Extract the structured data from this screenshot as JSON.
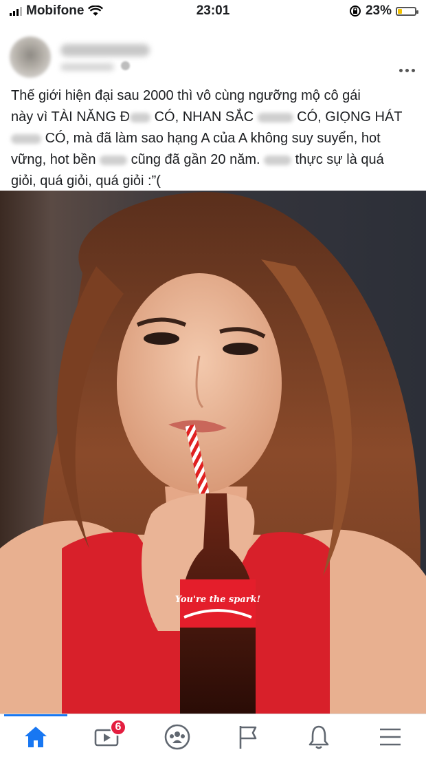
{
  "status_bar": {
    "carrier": "Mobifone",
    "time": "23:01",
    "battery": "23%",
    "battery_level": 0.23,
    "icons": [
      "signal-icon",
      "wifi-icon",
      "orientation-lock-icon",
      "battery-icon"
    ]
  },
  "post": {
    "more_label": "•••",
    "caption": {
      "line1": "Thế giới hiện đại sau 2000 thì vô cùng ngưỡng mộ cô gái",
      "line2_a": "này vì TÀI NĂNG Đ",
      "line2_b": "CÓ, NHAN SẮC",
      "line2_c": "CÓ, GIỌNG HÁT",
      "line3_a": "CÓ, mà đã làm sao hạng A của A không suy suyển, hot",
      "line4_a": "vững, hot bền",
      "line4_b": "cũng đã gần 20 năm.",
      "line4_c": "thực sự là quá",
      "line5": "giỏi, quá giỏi, quá giỏi :”("
    },
    "photo": {
      "bottle_text": "You're the spark!"
    }
  },
  "nav": {
    "tabs": [
      "home-icon",
      "watch-icon",
      "groups-icon",
      "pages-icon",
      "notifications-icon",
      "menu-icon"
    ],
    "watch_badge": "6",
    "accent": "#1877f2",
    "badge_color": "#e41e3f"
  }
}
